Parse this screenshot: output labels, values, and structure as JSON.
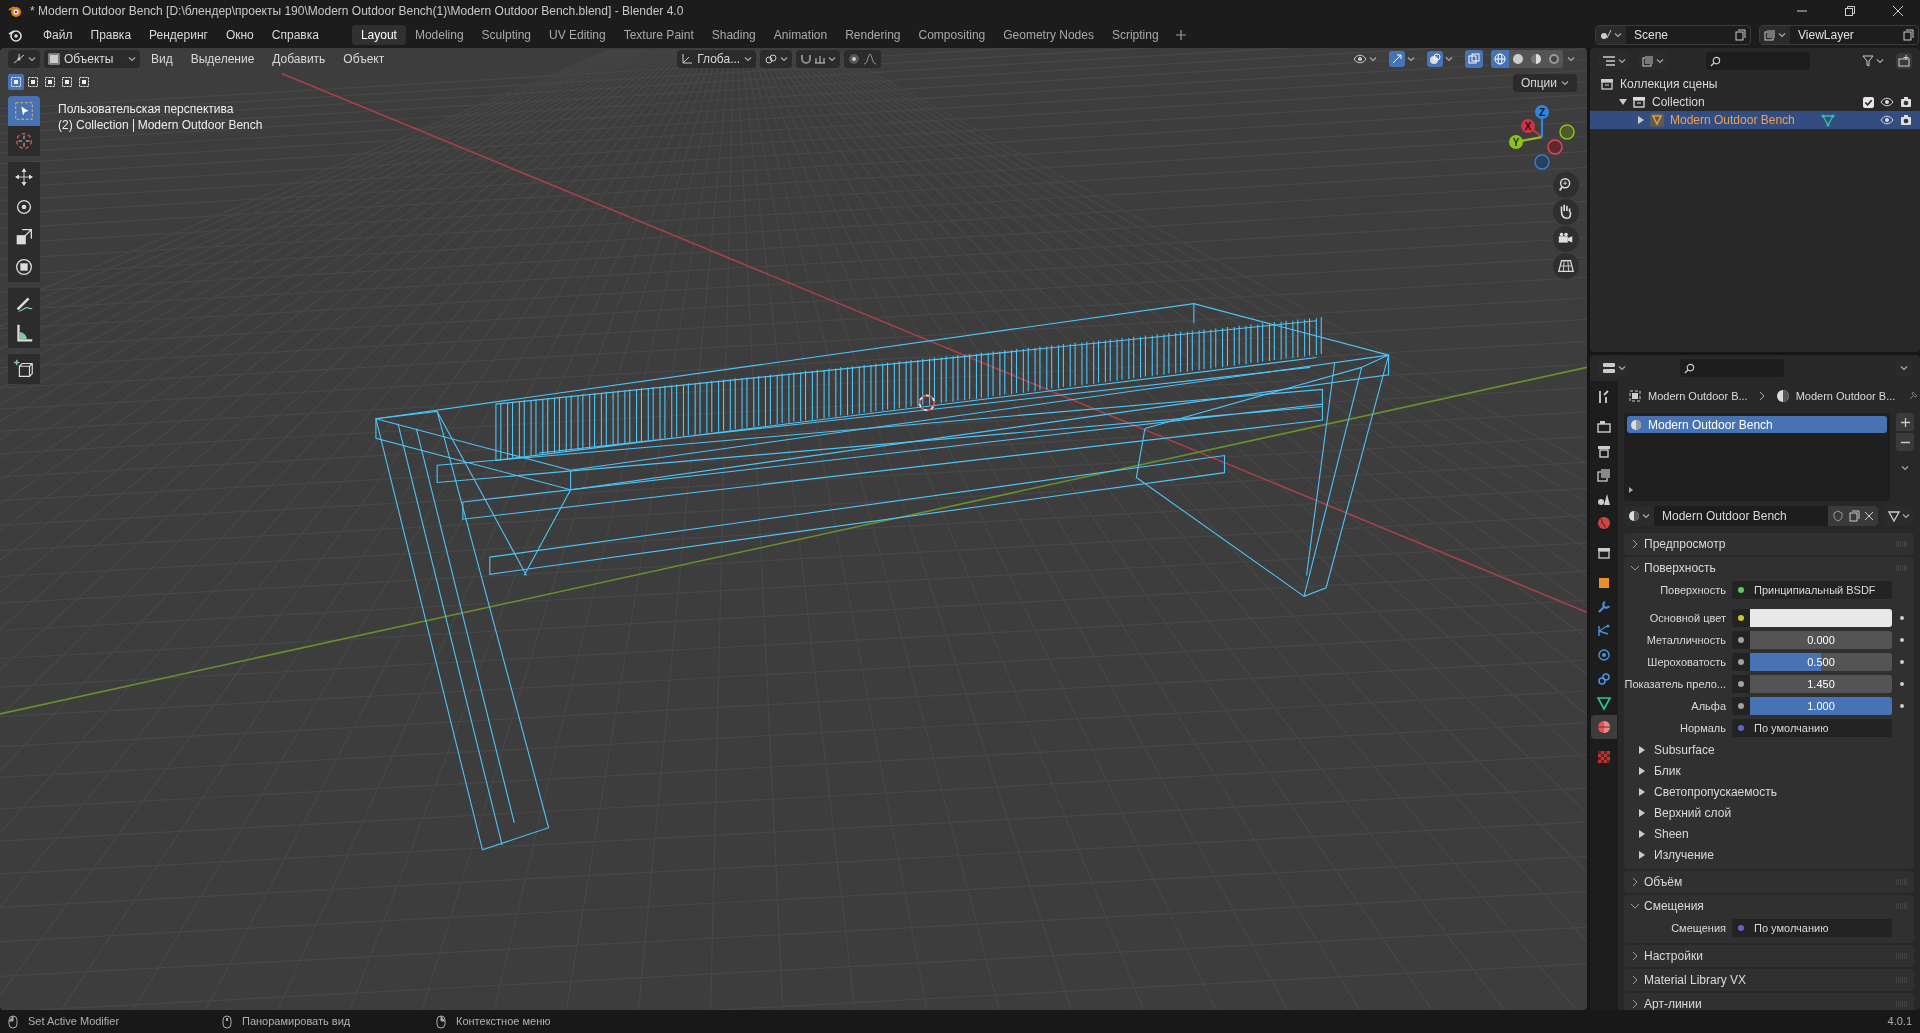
{
  "title_bar": {
    "title": "* Modern Outdoor Bench [D:\\блендер\\проекты 190\\Modern Outdoor Bench(1)\\Modern Outdoor Bench.blend] - Blender 4.0"
  },
  "menus": [
    "Файл",
    "Правка",
    "Рендеринг",
    "Окно",
    "Справка"
  ],
  "workspaces": [
    {
      "label": "Layout",
      "selected": true
    },
    {
      "label": "Modeling",
      "selected": false
    },
    {
      "label": "Sculpting",
      "selected": false
    },
    {
      "label": "UV Editing",
      "selected": false
    },
    {
      "label": "Texture Paint",
      "selected": false
    },
    {
      "label": "Shading",
      "selected": false
    },
    {
      "label": "Animation",
      "selected": false
    },
    {
      "label": "Rendering",
      "selected": false
    },
    {
      "label": "Compositing",
      "selected": false
    },
    {
      "label": "Geometry Nodes",
      "selected": false
    },
    {
      "label": "Scripting",
      "selected": false
    }
  ],
  "scene": "Scene",
  "view_layer": "ViewLayer",
  "viewport": {
    "mode": "Объекты",
    "menus": [
      "Вид",
      "Выделение",
      "Добавить",
      "Объект"
    ],
    "orientation": "Глоба...",
    "options": "Опции",
    "view_name": "Пользовательская перспектива",
    "collection": "(2) Collection",
    "object": "Modern Outdoor Bench",
    "axes": [
      "X",
      "Y",
      "Z"
    ],
    "select_modes": [
      {
        "selected": true
      },
      {
        "selected": false
      },
      {
        "selected": false
      },
      {
        "selected": false
      },
      {
        "selected": false
      }
    ],
    "tools": [
      {
        "kind": "select",
        "selected": true
      },
      {
        "kind": "cursor",
        "selected": false
      },
      {
        "kind": "move",
        "selected": false
      },
      {
        "kind": "rotate",
        "selected": false
      },
      {
        "kind": "scale",
        "selected": false
      },
      {
        "kind": "transform",
        "selected": false
      },
      {
        "kind": "annotate",
        "selected": false
      },
      {
        "kind": "measure",
        "selected": false
      },
      {
        "kind": "add_cube",
        "selected": false
      }
    ]
  },
  "outliner": {
    "items": [
      {
        "label": "Коллекция сцены",
        "kind": "scene",
        "selected": false,
        "children": [
          {
            "label": "Collection",
            "kind": "collection",
            "expanded": true,
            "checked": true,
            "selected": false,
            "children": [
              {
                "label": "Modern Outdoor Bench",
                "kind": "object",
                "expanded": false,
                "selected": true
              }
            ]
          }
        ]
      }
    ]
  },
  "properties": {
    "tabs": [
      {
        "kind": "tool",
        "selected": false
      },
      {
        "kind": "render",
        "selected": false
      },
      {
        "kind": "output",
        "selected": false
      },
      {
        "kind": "view_layer",
        "selected": false
      },
      {
        "kind": "scene",
        "selected": false
      },
      {
        "kind": "world",
        "selected": false
      },
      {
        "kind": "collection",
        "selected": false
      },
      {
        "kind": "object",
        "selected": false
      },
      {
        "kind": "modifiers",
        "selected": false
      },
      {
        "kind": "particles",
        "selected": false
      },
      {
        "kind": "physics",
        "selected": false
      },
      {
        "kind": "constraints",
        "selected": false
      },
      {
        "kind": "data",
        "selected": false
      },
      {
        "kind": "material",
        "selected": true
      },
      {
        "kind": "texture",
        "selected": false
      }
    ],
    "breadcrumb": [
      "Modern Outdoor B...",
      "Modern Outdoor B..."
    ],
    "slots": [
      {
        "label": "Modern Outdoor Bench",
        "selected": true
      }
    ],
    "material": "Modern Outdoor Bench",
    "panels": [
      {
        "title": "Предпросмотр",
        "expanded": false
      },
      {
        "title": "Поверхность",
        "expanded": true,
        "rows": [
          {
            "kind": "link",
            "label": "Поверхность",
            "value": "Принципиальный BSDF",
            "color": "#63c763"
          },
          {
            "kind": "swatch",
            "label": "Основной цвет",
            "color": "#c7c729"
          },
          {
            "kind": "number",
            "label": "Металличность",
            "value": "0.000",
            "color": "#a1a1a1"
          },
          {
            "kind": "slider",
            "label": "Шероховатость",
            "value": "0.500",
            "level": 0.5,
            "color": "#a1a1a1"
          },
          {
            "kind": "number",
            "label": "Показатель прело...",
            "value": "1.450",
            "color": "#a1a1a1"
          },
          {
            "kind": "slider",
            "label": "Альфа",
            "value": "1.000",
            "level": 1,
            "color": "#a1a1a1"
          },
          {
            "kind": "link",
            "label": "Нормаль",
            "value": "По умолчанию",
            "color": "#6363c7"
          },
          {
            "kind": "subpanel",
            "label": "Subsurface",
            "expanded": false
          },
          {
            "kind": "subpanel",
            "label": "Блик",
            "expanded": false
          },
          {
            "kind": "subpanel",
            "label": "Светопропускаемость",
            "expanded": false
          },
          {
            "kind": "subpanel",
            "label": "Верхний слой",
            "expanded": false
          },
          {
            "kind": "subpanel",
            "label": "Sheen",
            "expanded": false
          },
          {
            "kind": "subpanel",
            "label": "Излучение",
            "expanded": false
          }
        ]
      },
      {
        "title": "Объём",
        "expanded": false
      },
      {
        "title": "Смещения",
        "expanded": true,
        "rows": [
          {
            "kind": "link",
            "label": "Смещения",
            "value": "По умолчанию",
            "color": "#6363c7"
          }
        ]
      },
      {
        "title": "Настройки",
        "expanded": false
      },
      {
        "title": "Material Library VX",
        "expanded": false
      },
      {
        "title": "Арт-линии",
        "expanded": false
      }
    ]
  },
  "status_bar": {
    "hints": [
      "Set Active Modifier",
      "Панорамировать вид",
      "Контекстное меню"
    ],
    "version": "4.0.1"
  }
}
